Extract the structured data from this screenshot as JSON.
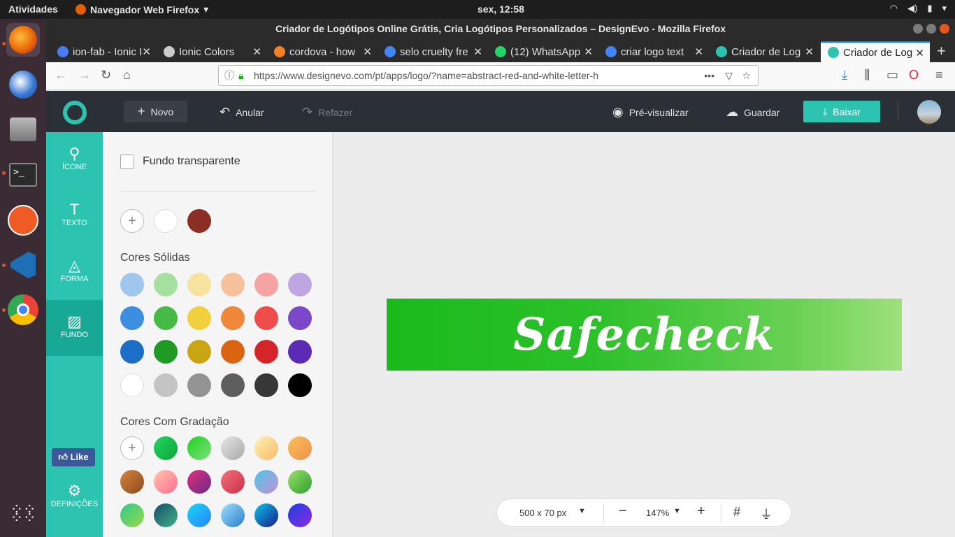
{
  "system": {
    "activities": "Atividades",
    "app_menu": "Navegador Web Firefox",
    "clock": "sex, 12:58"
  },
  "window": {
    "title": "Criador de Logótipos Online Grátis, Cria Logótipos Personalizados – DesignEvo - Mozilla Firefox"
  },
  "tabs": [
    {
      "label": "ion-fab - Ionic I",
      "color": "#4a7cf7"
    },
    {
      "label": "Ionic Colors",
      "color": "#cccccc"
    },
    {
      "label": "cordova - how",
      "color": "#f48024"
    },
    {
      "label": "selo cruelty fre",
      "color": "#4285f4"
    },
    {
      "label": "(12) WhatsApp",
      "color": "#25d366"
    },
    {
      "label": "criar logo text",
      "color": "#4285f4"
    },
    {
      "label": "Criador de Log",
      "color": "#2cc4b0"
    },
    {
      "label": "Criador de Log",
      "color": "#2cc4b0"
    }
  ],
  "address": {
    "url": "https://www.designevo.com/pt/apps/logo/?name=abstract-red-and-white-letter-h"
  },
  "toolbar": {
    "new": "Novo",
    "undo": "Anular",
    "redo": "Refazer",
    "preview": "Pré-visualizar",
    "save": "Guardar",
    "download": "Baixar"
  },
  "sidenav": [
    {
      "label": "ÍCONE",
      "icon": "search-icon"
    },
    {
      "label": "TEXTO",
      "icon": "text-icon"
    },
    {
      "label": "FORMA",
      "icon": "shape-icon"
    },
    {
      "label": "FUNDO",
      "icon": "background-icon"
    }
  ],
  "like_label": "Like",
  "settings_label": "DEFINIÇÕES",
  "panel": {
    "transparent": "Fundo transparente",
    "recent": [
      "#ffffff",
      "#8b2e24"
    ],
    "solid_title": "Cores Sólidas",
    "solid": [
      [
        "#9fc7ee",
        "#a6e0a0",
        "#f7e3a0",
        "#f6c19c",
        "#f5a3a3",
        "#bfa6e3"
      ],
      [
        "#3b8ee0",
        "#45bb45",
        "#f2cf3f",
        "#f0873a",
        "#ef4c4c",
        "#7a48c8"
      ],
      [
        "#1c6fc7",
        "#1f9a23",
        "#c9a413",
        "#da6412",
        "#d6252a",
        "#5c2bb6"
      ],
      [
        "#ffffff",
        "#c4c4c4",
        "#939393",
        "#5e5e5e",
        "#373737",
        "#000000"
      ]
    ],
    "gradient_title": "Cores Com Gradação",
    "gradients": [
      [
        "",
        "linear-gradient(135deg,#1ed65f,#11a53a)",
        "linear-gradient(135deg,#1fd21f,#7fe07f)",
        "linear-gradient(135deg,#e6e6e6,#a8a8a8)",
        "linear-gradient(135deg,#fff2b0,#f5b96c)",
        "linear-gradient(135deg,#f7c25a,#f08f4e)"
      ],
      [
        "linear-gradient(135deg,#d5853c,#8a4b1f)",
        "linear-gradient(135deg,#ffc3b0,#ff6f8f)",
        "linear-gradient(135deg,#e0307a,#6b2a8c)",
        "linear-gradient(135deg,#f5707a,#c8324c)",
        "linear-gradient(135deg,#4ac7e8,#c68fd6)",
        "linear-gradient(135deg,#9ae06a,#2e9e2e)"
      ],
      [
        "linear-gradient(135deg,#2ec98a,#9ad94a)",
        "linear-gradient(135deg,#174b66,#3fb48a)",
        "linear-gradient(135deg,#18d8f0,#2b7fff)",
        "linear-gradient(135deg,#9fe1ff,#2a7ccc)",
        "linear-gradient(135deg,#0cc6e8,#1a1a8c)",
        "linear-gradient(135deg,#1f3fe0,#8a2be2)"
      ]
    ]
  },
  "logo": {
    "text": "Safecheck"
  },
  "bottom": {
    "size": "500 x 70 px",
    "zoom": "147%"
  }
}
